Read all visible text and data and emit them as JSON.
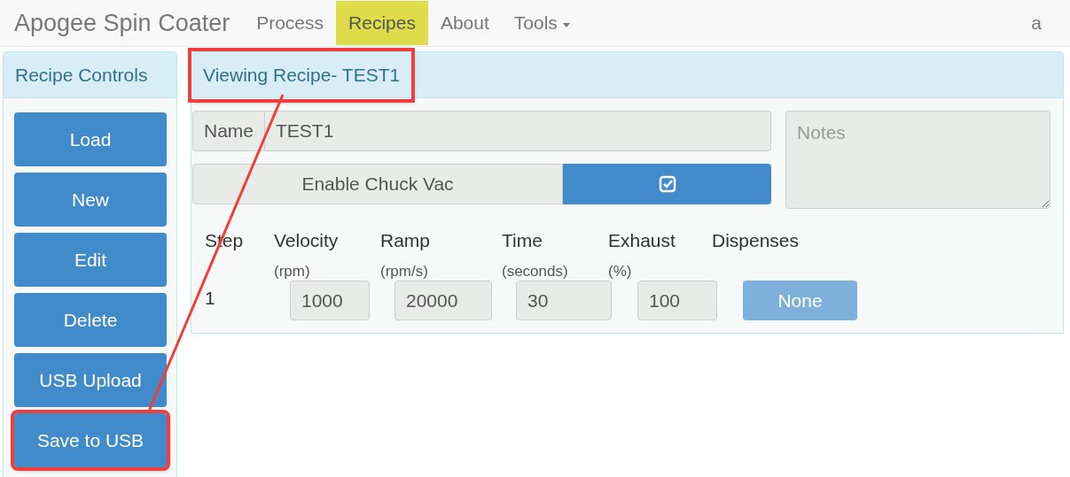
{
  "navbar": {
    "brand": "Apogee Spin Coater",
    "items": [
      {
        "label": "Process",
        "selected": false,
        "dropdown": false
      },
      {
        "label": "Recipes",
        "selected": true,
        "dropdown": false
      },
      {
        "label": "About",
        "selected": false,
        "dropdown": false
      },
      {
        "label": "Tools",
        "selected": false,
        "dropdown": true
      }
    ],
    "user": "a"
  },
  "controls": {
    "title": "Recipe Controls",
    "buttons": [
      {
        "label": "Load",
        "highlighted": false
      },
      {
        "label": "New",
        "highlighted": false
      },
      {
        "label": "Edit",
        "highlighted": false
      },
      {
        "label": "Delete",
        "highlighted": false
      },
      {
        "label": "USB Upload",
        "highlighted": false
      },
      {
        "label": "Save to USB",
        "highlighted": true
      }
    ]
  },
  "recipe": {
    "title": "Viewing Recipe- TEST1",
    "highlighted": true,
    "name_label": "Name",
    "name_value": "TEST1",
    "notes_placeholder": "Notes",
    "chuck_vac": {
      "label": "Enable Chuck Vac",
      "checked": true
    },
    "columns": [
      {
        "title": "Step"
      },
      {
        "title": "Velocity",
        "unit": "(rpm)"
      },
      {
        "title": "Ramp",
        "unit": "(rpm/s)"
      },
      {
        "title": "Time",
        "unit": "(seconds)"
      },
      {
        "title": "Exhaust",
        "unit": "(%)"
      },
      {
        "title": "Dispenses"
      }
    ],
    "steps": [
      {
        "step": "1",
        "velocity": "1000",
        "ramp": "20000",
        "time": "30",
        "exhaust": "100",
        "dispenses": "None"
      }
    ]
  },
  "callout_line": true
}
